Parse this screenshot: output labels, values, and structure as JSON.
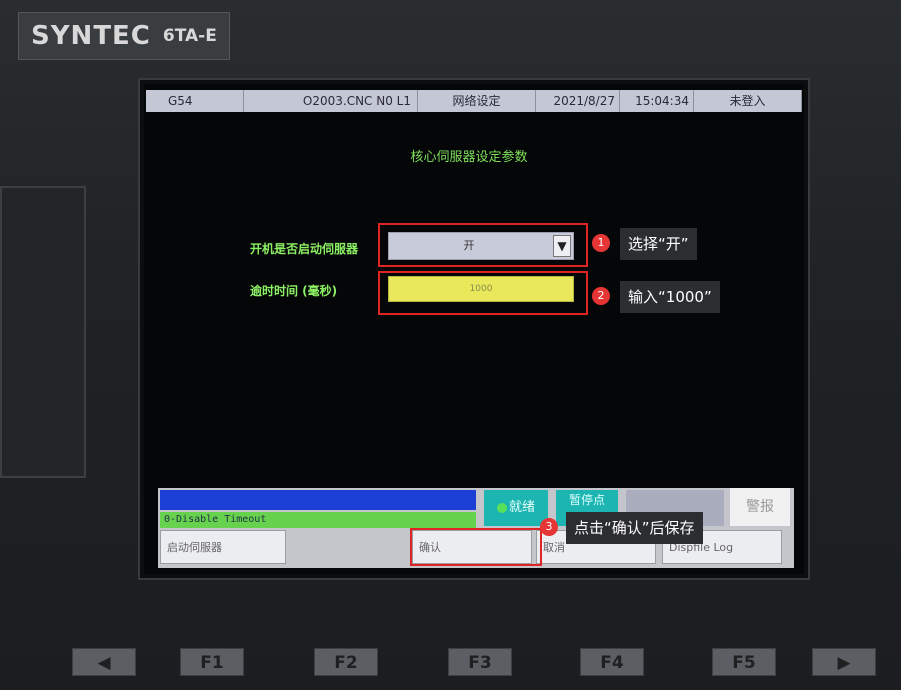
{
  "device": {
    "brand": "SYNTEC",
    "model": "6TA-E"
  },
  "topbar": {
    "coord": "G54",
    "program": "O2003.CNC N0 L1",
    "screen": "网络设定",
    "date": "2021/8/27",
    "time": "15:04:34",
    "login": "未登入"
  },
  "form": {
    "title": "核心伺服器设定参数",
    "start_servo_label": "开机是否启动伺服器",
    "start_servo_value": "开",
    "timeout_label": "逾时时间 (毫秒)",
    "timeout_value": "1000"
  },
  "status": {
    "message": "0-Disable Timeout",
    "ready": "就绪",
    "pause": "暂停点",
    "alarm": "警报"
  },
  "softkeys": [
    {
      "label": "启动伺服器"
    },
    {
      "label": "确认"
    },
    {
      "label": "取消"
    },
    {
      "label": "Dispfile Log"
    }
  ],
  "annotations": [
    {
      "step": "1",
      "text": "选择“开”"
    },
    {
      "step": "2",
      "text": "输入“1000”"
    },
    {
      "step": "3",
      "text": "点击“确认”后保存"
    }
  ],
  "function_keys": [
    "◀",
    "F1",
    "F2",
    "F3",
    "F4",
    "F5",
    "▶"
  ],
  "colors": {
    "highlight": "#e02424",
    "label_green": "#8cf064",
    "input_yellow": "#e9e85a"
  }
}
